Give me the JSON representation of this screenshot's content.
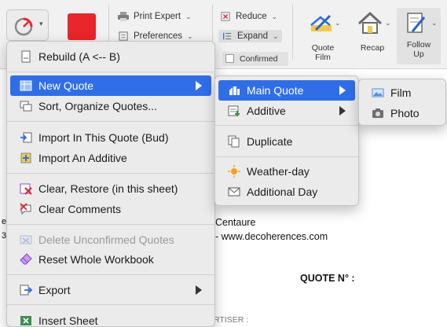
{
  "ribbon": {
    "print_expert": "Print Expert",
    "preferences": "Preferences",
    "reduce": "Reduce",
    "expand": "Expand",
    "confirmed": "Confirmed",
    "quote_film": [
      "Quote",
      "Film"
    ],
    "recap": "Recap",
    "follow_up": [
      "Follow",
      "Up"
    ],
    "accent_color": "#e8262c"
  },
  "sheet": {
    "centaure": "Centaure",
    "website": "- www.decoherences.com",
    "quote_no": "QUOTE N° :",
    "advertiser": "RTISER :"
  },
  "main_menu": {
    "items": [
      {
        "label": "Rebuild (A <-- B)",
        "icon": "rebuild-icon"
      },
      {
        "label": "New Quote",
        "icon": "table-icon",
        "submenu": true,
        "highlighted": true
      },
      {
        "label": "Sort, Organize Quotes...",
        "icon": "sort-icon"
      },
      {
        "label": "Import In This Quote (Bud)",
        "icon": "import-icon"
      },
      {
        "label": "Import An Additive",
        "icon": "import-additive-icon"
      },
      {
        "label": "Clear, Restore (in this sheet)",
        "icon": "clear-restore-icon"
      },
      {
        "label": "Clear Comments",
        "icon": "clear-comments-icon"
      },
      {
        "label": "Delete Unconfirmed Quotes",
        "icon": "delete-icon",
        "disabled": true
      },
      {
        "label": "Reset Whole Workbook",
        "icon": "eraser-icon"
      },
      {
        "label": "Export",
        "icon": "export-icon",
        "submenu": true
      },
      {
        "label": "Insert Sheet",
        "icon": "insert-sheet-icon"
      }
    ]
  },
  "sub_menu": {
    "items": [
      {
        "label": "Main Quote",
        "icon": "main-quote-icon",
        "submenu": true,
        "highlighted": true
      },
      {
        "label": "Additive",
        "icon": "additive-icon",
        "submenu": true
      },
      {
        "label": "Duplicate",
        "icon": "duplicate-icon"
      },
      {
        "label": "Weather-day",
        "icon": "weather-icon"
      },
      {
        "label": "Additional Day",
        "icon": "envelope-icon"
      }
    ]
  },
  "sub_sub_menu": {
    "items": [
      {
        "label": "Film",
        "icon": "film-icon"
      },
      {
        "label": "Photo",
        "icon": "camera-icon"
      }
    ]
  },
  "colors": {
    "highlight": "#2f6ee7",
    "menu_bg": "#ebebeb"
  }
}
